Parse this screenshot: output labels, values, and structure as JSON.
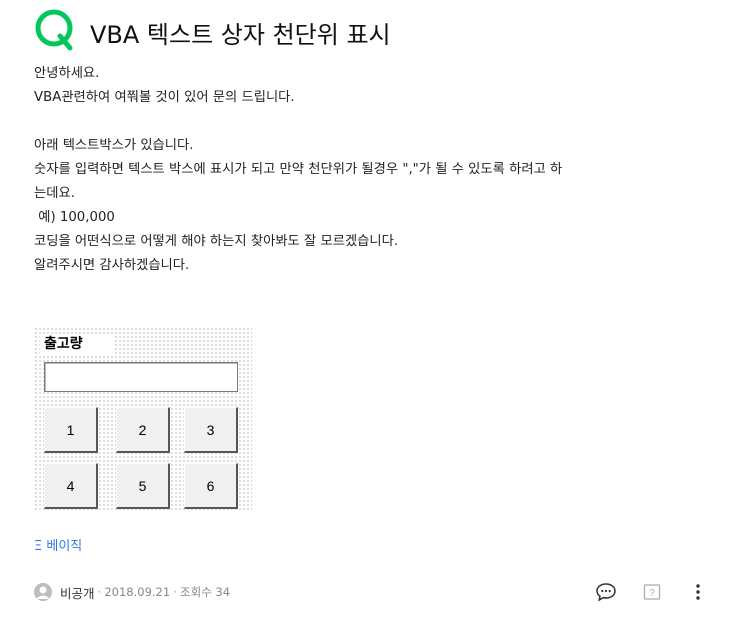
{
  "question": {
    "title": "VBA 텍스트 상자 천단위 표시",
    "paragraphs": [
      "안녕하세요.",
      "VBA관련하여 여쭤볼 것이 있어 문의 드립니다.",
      "",
      "아래 텍스트박스가 있습니다.",
      "숫자를 입력하면 텍스트 박스에 표시가 되고 만약 천단위가 될경우 \",\"가 될 수 있도록 하려고 하",
      "는데요.",
      " 예) 100,000",
      "코딩을 어떤식으로 어떻게 해야 하는지 찾아봐도 잘 모르겠습니다.",
      "알려주시면 감사하겠습니다."
    ]
  },
  "form_preview": {
    "label": "출고량",
    "input_value": "",
    "keys": [
      "1",
      "2",
      "3",
      "4",
      "5",
      "6"
    ]
  },
  "category": {
    "label": "베이직",
    "prefix_glyph": "Ξ"
  },
  "footer": {
    "author": "비공개",
    "date": "2018.09.21",
    "views": "조회수 34",
    "separator": "·"
  },
  "icons": {
    "brand": "q-logo-icon",
    "comment": "comment-icon",
    "report": "report-icon",
    "more": "more-vertical-icon"
  },
  "colors": {
    "brand_green": "#03c75a",
    "link_blue": "#2c7be5"
  }
}
